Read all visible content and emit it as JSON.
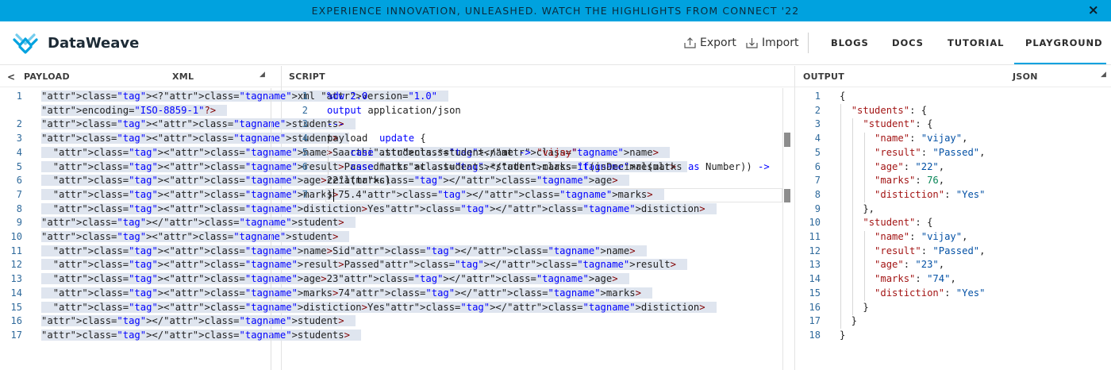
{
  "banner": {
    "text": "EXPERIENCE INNOVATION, UNLEASHED. WATCH THE HIGHLIGHTS FROM CONNECT '22",
    "close": "×"
  },
  "header": {
    "brand": "DataWeave",
    "export_label": "Export",
    "import_label": "Import",
    "nav": [
      "BLOGS",
      "DOCS",
      "TUTORIAL",
      "PLAYGROUND"
    ],
    "active_nav": "PLAYGROUND"
  },
  "payload_panel": {
    "back": "<",
    "title": "PAYLOAD",
    "format": "XML",
    "caret": "◢",
    "line_numbers": [
      "1",
      "",
      "2",
      "3",
      "4",
      "5",
      "6",
      "7",
      "8",
      "9",
      "10",
      "11",
      "12",
      "13",
      "14",
      "15",
      "16",
      "17"
    ],
    "lines": [
      "<?xml version=\"1.0\"",
      "encoding=\"ISO-8859-1\"?>",
      "<students>",
      "<student>",
      "  <name>Saarthi</name>",
      "  <result>Passed</result>",
      "  <age>22</age>",
      "  <marks>75.4</marks>",
      "  <distiction>Yes</distiction>",
      "</student>",
      "<student>",
      "  <name>Sid</name>",
      "  <result>Passed</result>",
      "  <age>23</age>",
      "  <marks>74</marks>",
      "  <distiction>Yes</distiction>",
      "</student>",
      "</students>"
    ]
  },
  "script_panel": {
    "title": "SCRIPT",
    "line_numbers": [
      "1",
      "2",
      "3",
      "4",
      "5",
      "6",
      "",
      "7"
    ],
    "lines": [
      "%dw 2.0",
      "output application/json",
      "---",
      "payload  update {",
      "    case .students.*student.name -> \"vijay\"",
      "    case marks at .students.*student.marks if(isDecimal(marks as Number)) ->",
      "ceil(marks)",
      "}"
    ]
  },
  "output_panel": {
    "title": "OUTPUT",
    "format": "JSON",
    "caret": "◢",
    "line_numbers": [
      "1",
      "2",
      "3",
      "4",
      "5",
      "6",
      "7",
      "8",
      "9",
      "10",
      "11",
      "12",
      "13",
      "14",
      "15",
      "16",
      "17",
      "18"
    ],
    "lines": [
      "{",
      "  \"students\": {",
      "    \"student\": {",
      "      \"name\": \"vijay\",",
      "      \"result\": \"Passed\",",
      "      \"age\": \"22\",",
      "      \"marks\": 76,",
      "      \"distiction\": \"Yes\"",
      "    },",
      "    \"student\": {",
      "      \"name\": \"vijay\",",
      "      \"result\": \"Passed\",",
      "      \"age\": \"23\",",
      "      \"marks\": \"74\",",
      "      \"distiction\": \"Yes\"",
      "    }",
      "  }",
      "}"
    ]
  },
  "colors": {
    "accent": "#00a2df",
    "selection": "#dfe5ef",
    "line_number": "#2f6a9c"
  },
  "icons": [
    "logo-icon",
    "export-icon",
    "import-icon",
    "close-icon",
    "back-chevron-icon"
  ]
}
